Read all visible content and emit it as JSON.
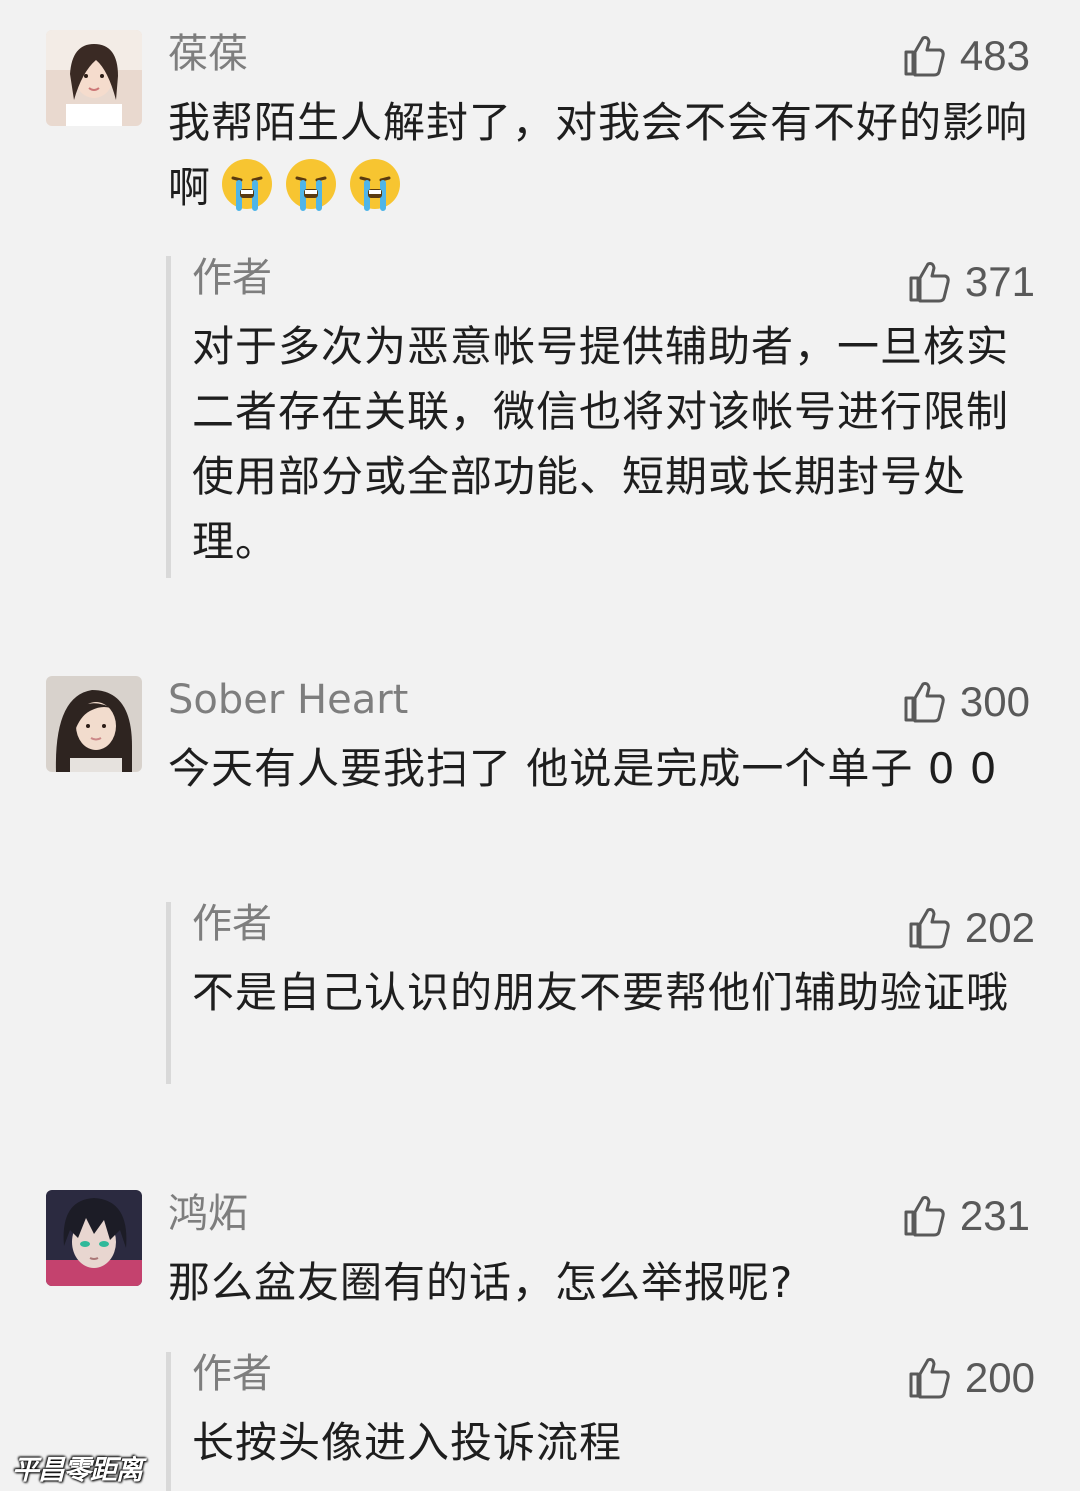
{
  "colors": {
    "background": "#f2f2f2",
    "text": "#1e1e1e",
    "name": "#7e7e7e",
    "like": "#595959",
    "reply_bar": "#d9d9d9"
  },
  "comments": [
    {
      "user": "葆葆",
      "likes": "483",
      "text": "我帮陌生人解封了，对我会不会有不好的影响啊",
      "emoji": [
        "crying-face-icon",
        "crying-face-icon",
        "crying-face-icon"
      ],
      "reply": {
        "author": "作者",
        "likes": "371",
        "text": "对于多次为恶意帐号提供辅助者，一旦核实二者存在关联，微信也将对该帐号进行限制使用部分或全部功能、短期或长期封号处理。"
      }
    },
    {
      "user": "Sober Heart",
      "likes": "300",
      "text": "今天有人要我扫了 他说是完成一个单子 0 0",
      "reply": {
        "author": "作者",
        "likes": "202",
        "text": "不是自己认识的朋友不要帮他们辅助验证哦"
      }
    },
    {
      "user": "鸿炻",
      "likes": "231",
      "text": "那么盆友圈有的话，怎么举报呢?",
      "reply": {
        "author": "作者",
        "likes": "200",
        "text": "长按头像进入投诉流程"
      }
    }
  ],
  "watermark": "平昌零距离"
}
